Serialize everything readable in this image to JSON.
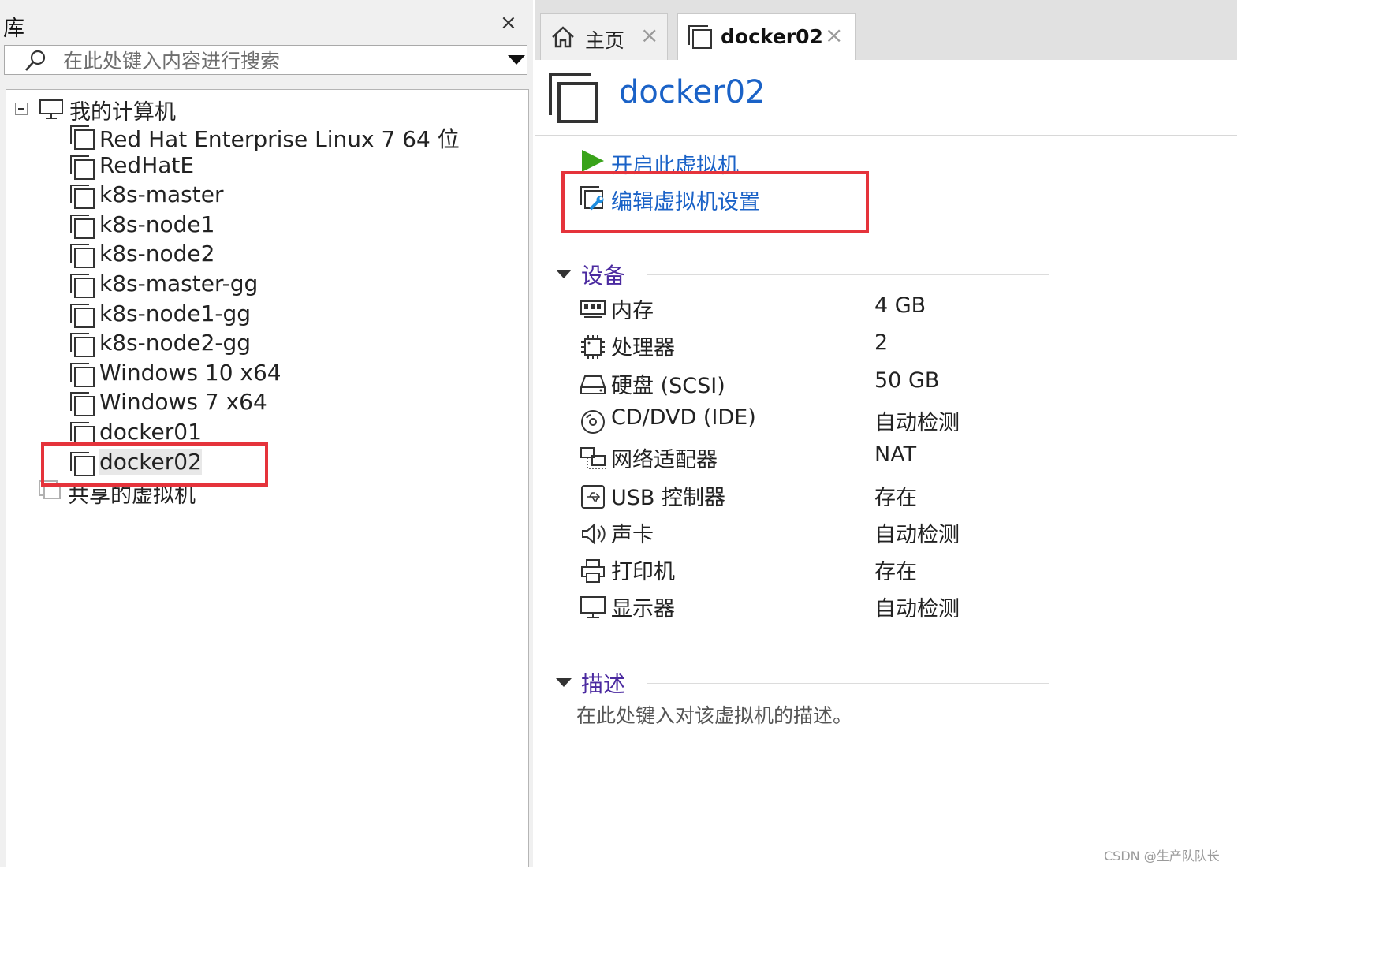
{
  "library": {
    "title": "库",
    "close_glyph": "×",
    "search_placeholder": "在此处键入内容进行搜索",
    "root_label": "我的计算机",
    "vms": [
      "Red Hat Enterprise Linux 7 64 位",
      "RedHatE",
      "k8s-master",
      "k8s-node1",
      "k8s-node2",
      "k8s-master-gg",
      "k8s-node1-gg",
      "k8s-node2-gg",
      "Windows 10 x64",
      "Windows 7 x64",
      "docker01",
      "docker02"
    ],
    "selected_vm": "docker02",
    "shared_label": "共享的虚拟机"
  },
  "tabs": [
    {
      "label": "主页",
      "icon": "home-icon",
      "close_glyph": "×"
    },
    {
      "label": "docker02",
      "icon": "vm-icon",
      "close_glyph": "×",
      "active": true
    }
  ],
  "vm": {
    "title": "docker02",
    "actions": {
      "start": "开启此虚拟机",
      "edit": "编辑虚拟机设置"
    },
    "devices_heading": "设备",
    "devices": [
      {
        "icon": "memory-icon",
        "name": "内存",
        "value": "4 GB"
      },
      {
        "icon": "cpu-icon",
        "name": "处理器",
        "value": "2"
      },
      {
        "icon": "harddisk-icon",
        "name": "硬盘 (SCSI)",
        "value": "50 GB"
      },
      {
        "icon": "cdrom-icon",
        "name": "CD/DVD (IDE)",
        "value": "自动检测"
      },
      {
        "icon": "network-icon",
        "name": "网络适配器",
        "value": "NAT"
      },
      {
        "icon": "usb-icon",
        "name": "USB 控制器",
        "value": "存在"
      },
      {
        "icon": "speaker-icon",
        "name": "声卡",
        "value": "自动检测"
      },
      {
        "icon": "printer-icon",
        "name": "打印机",
        "value": "存在"
      },
      {
        "icon": "display-icon",
        "name": "显示器",
        "value": "自动检测"
      }
    ],
    "description_heading": "描述",
    "description_placeholder": "在此处键入对该虚拟机的描述。"
  },
  "colors": {
    "link_blue": "#1a62c7",
    "section_purple": "#4b2aa0",
    "highlight_red": "#e5333b",
    "play_green": "#39a31a"
  },
  "watermark": "CSDN @生产队队长"
}
